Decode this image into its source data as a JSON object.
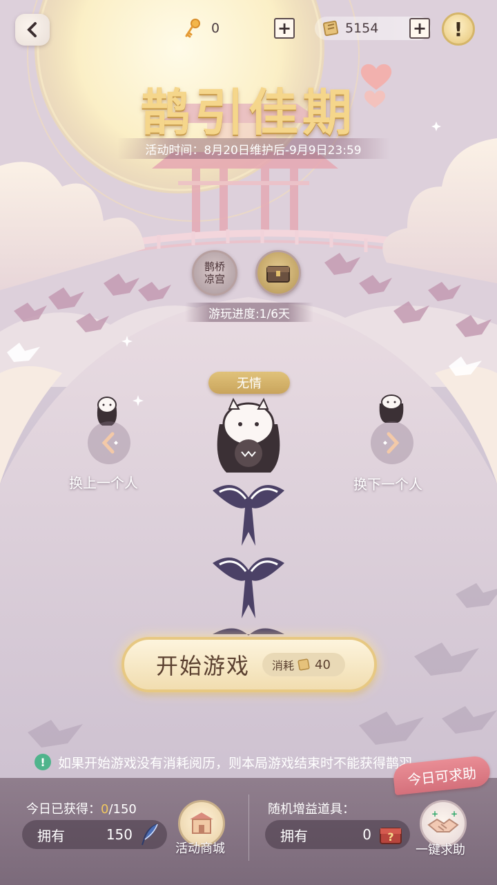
{
  "top_bar": {
    "key_count": "0",
    "scroll_count": "5154",
    "plus_label": "+",
    "help_label": "!"
  },
  "event": {
    "title": "鹊引佳期",
    "time": "活动时间：8月20日维护后-9月9日23:59"
  },
  "progress": {
    "badge_left_text": "鹊桥\n凉宫",
    "text": "游玩进度:1/6天"
  },
  "character": {
    "name": "无情",
    "prev_label": "换上一个人",
    "next_label": "换下一个人"
  },
  "start": {
    "label": "开始游戏",
    "cost_label": "消耗",
    "cost_value": "40"
  },
  "tip": {
    "icon": "!",
    "text": "如果开始游戏没有消耗阅历，则本局游戏结束时不能获得鹊羽"
  },
  "bottom": {
    "today_label": "今日已获得：",
    "today_value": "0",
    "today_total": "/150",
    "own_label": "拥有",
    "own_value": "150",
    "shop_label": "活动商城",
    "random_label": "随机增益道具：",
    "own_label2": "拥有",
    "own_value2": "0",
    "help_badge": "今日可求助",
    "help_label": "一键求助"
  },
  "colors": {
    "title_gold": "#f5d68b",
    "accent_gold": "#c9a45c",
    "highlight_value": "#f0c860",
    "tip_green": "#4fb48c",
    "help_pink": "#d4707b"
  },
  "icons": [
    "back-arrow-icon",
    "key-icon",
    "scroll-icon",
    "plus-icon",
    "exclamation-icon",
    "feather-icon",
    "treasure-chest-icon",
    "handshake-icon",
    "shop-icon",
    "chevron-left-icon",
    "chevron-right-icon"
  ]
}
